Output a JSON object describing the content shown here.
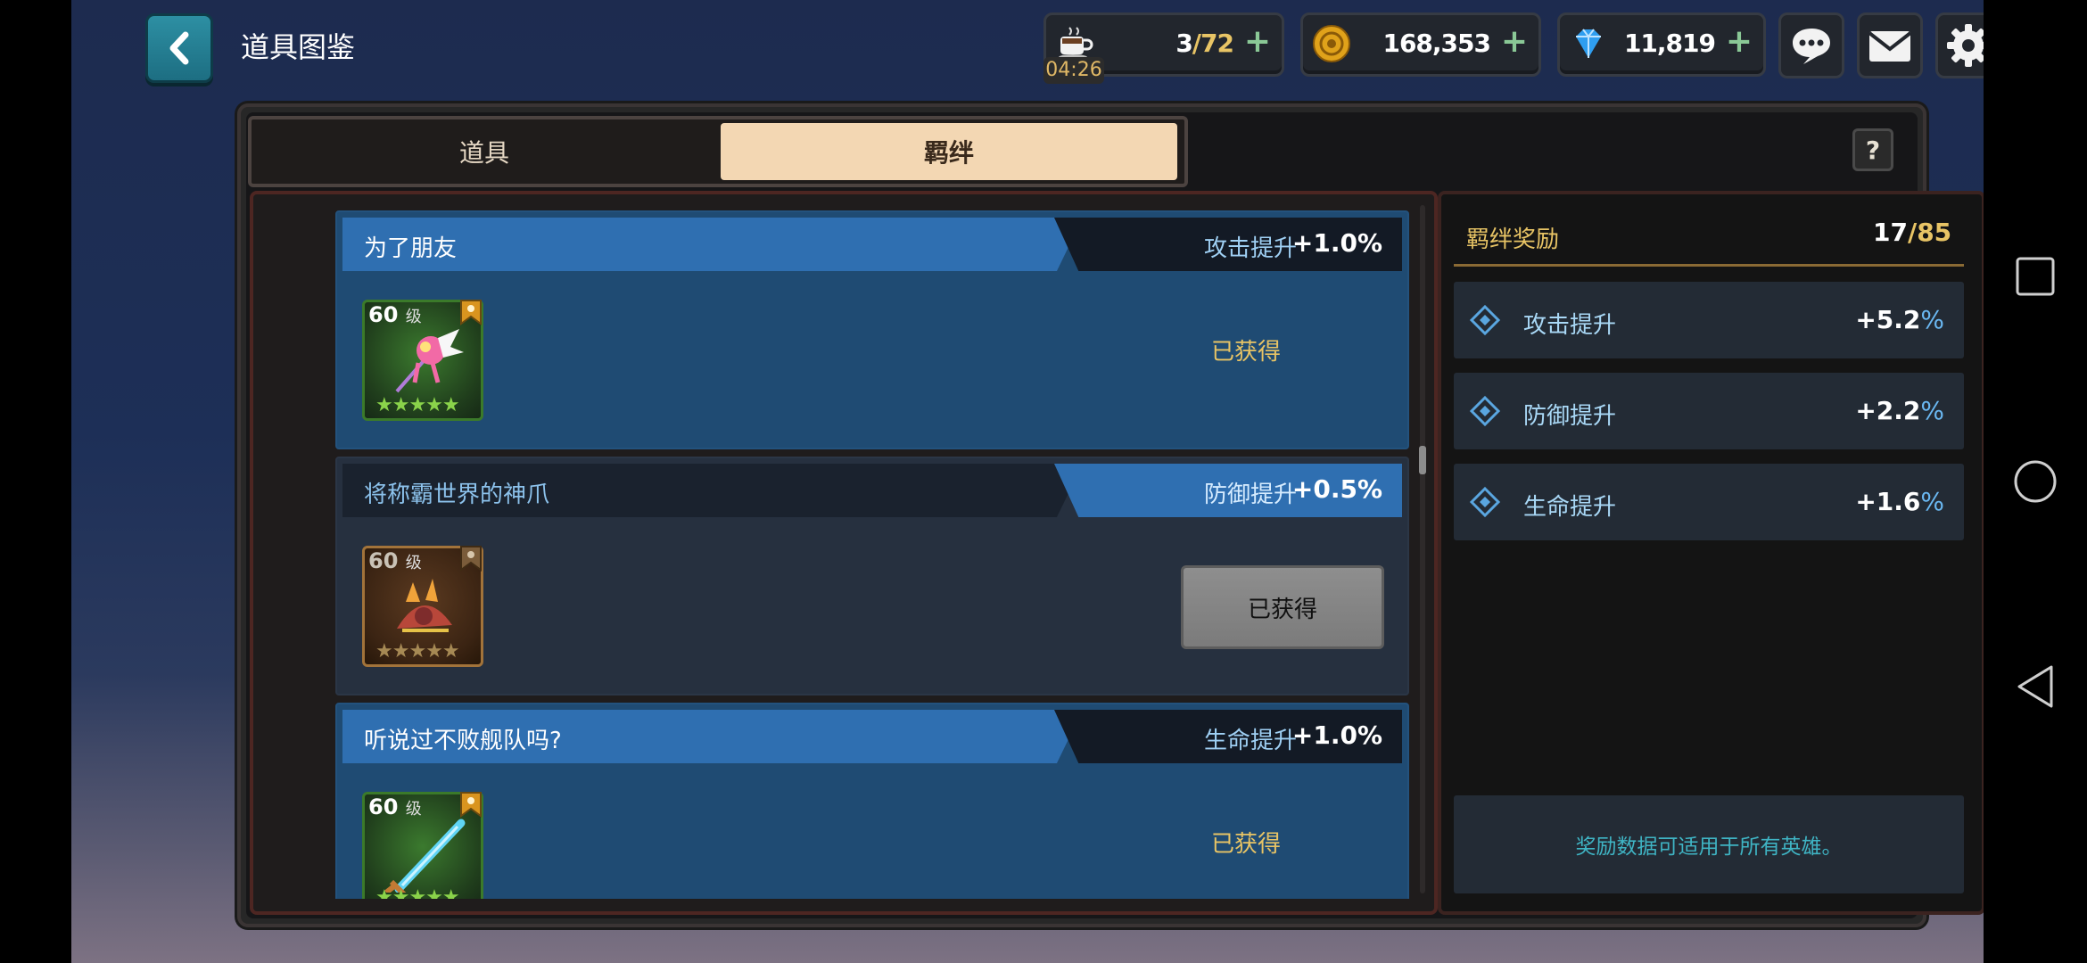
{
  "header": {
    "title": "道具图鉴",
    "stamina": {
      "current": "3",
      "max": "/72",
      "timer": "04:26"
    },
    "gold": "168,353",
    "gems": "11,819"
  },
  "tabs": [
    {
      "label": "道具",
      "selected": false
    },
    {
      "label": "羁绊",
      "selected": true
    }
  ],
  "help_label": "?",
  "bonds": [
    {
      "name": "为了朋友",
      "stat": "攻击提升",
      "value": "+1.0%",
      "level": "60",
      "level_unit": "级",
      "status": "已获得",
      "stars": "★★★★★"
    },
    {
      "name": "将称霸世界的神爪",
      "stat": "防御提升",
      "value": "+0.5%",
      "level": "60",
      "level_unit": "级",
      "status": "已获得",
      "stars": "★★★★★"
    },
    {
      "name": "听说过不败舰队吗?",
      "stat": "生命提升",
      "value": "+1.0%",
      "level": "60",
      "level_unit": "级",
      "status": "已获得",
      "stars": "★★★★★"
    }
  ],
  "rewards": {
    "title": "羁绊奖励",
    "count": "17",
    "total": "/85",
    "items": [
      {
        "label": "攻击提升",
        "value": "+5.2",
        "unit": "%"
      },
      {
        "label": "防御提升",
        "value": "+2.2",
        "unit": "%"
      },
      {
        "label": "生命提升",
        "value": "+1.6",
        "unit": "%"
      }
    ],
    "note": "奖励数据可适用于所有英雄。"
  },
  "colors": {
    "accent_blue": "#2f6fb1",
    "gold_text": "#e8c465",
    "tab_selected": "#f3d7b3"
  },
  "icons": {
    "back": "chevron-left-icon",
    "stamina": "coffee-cup-icon",
    "gold": "gold-coin-icon",
    "gems": "gem-icon",
    "chat": "chat-bubble-icon",
    "mail": "mail-icon",
    "settings": "gear-icon"
  }
}
